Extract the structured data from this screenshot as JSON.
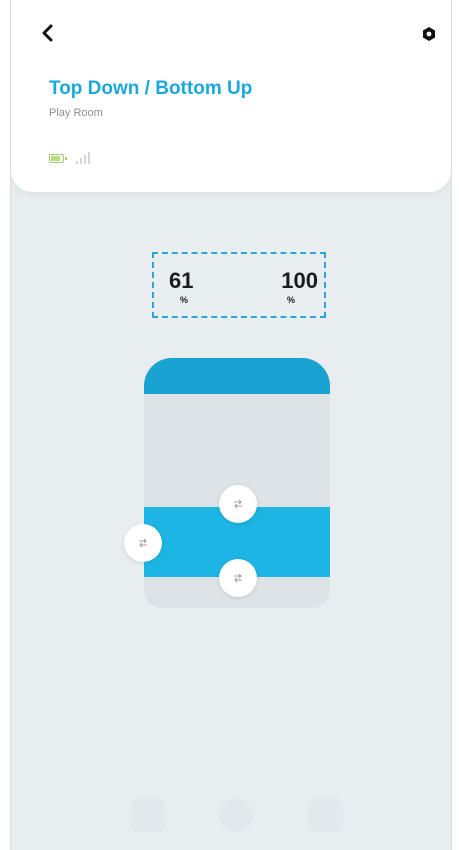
{
  "header": {
    "title": "Top Down / Bottom Up",
    "subtitle": "Play Room",
    "back_icon": "chevron-left-icon",
    "settings_icon": "gear-icon"
  },
  "status": {
    "battery_icon": "battery-icon",
    "battery_color": "#9fd06a",
    "signal_icon": "signal-bars-icon"
  },
  "positions": {
    "top": {
      "value": "61",
      "unit": "%"
    },
    "bottom": {
      "value": "100",
      "unit": "%"
    }
  },
  "shade": {
    "top_rail_position_percent": 61,
    "bottom_rail_position_percent": 100,
    "headrail_color": "#1aa3d2",
    "fabric_color": "#1db5e4"
  },
  "colors": {
    "accent": "#1aa9de",
    "background": "#e8eef0",
    "selection_border": "#29a8d8"
  }
}
